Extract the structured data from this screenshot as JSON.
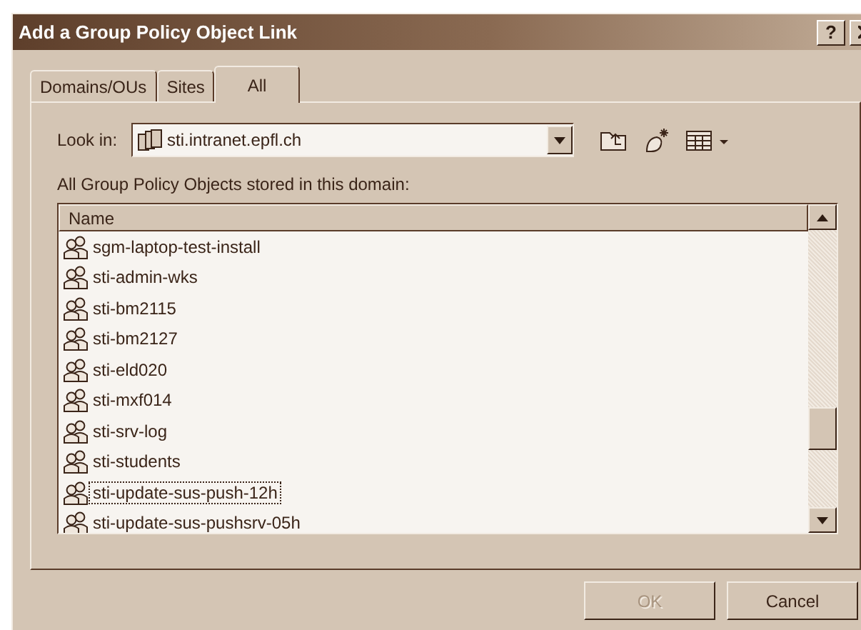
{
  "window": {
    "title": "Add a Group Policy Object Link",
    "help": "?"
  },
  "tabs": [
    {
      "label": "Domains/OUs",
      "selected": false
    },
    {
      "label": "Sites",
      "selected": false
    },
    {
      "label": "All",
      "selected": true
    }
  ],
  "look_in": {
    "label": "Look in:",
    "value": "sti.intranet.epfl.ch"
  },
  "list_caption": "All Group Policy Objects stored in this domain:",
  "list": {
    "column": "Name",
    "items": [
      {
        "name": "sgm-laptop-test-install",
        "selected": false
      },
      {
        "name": "sti-admin-wks",
        "selected": false
      },
      {
        "name": "sti-bm2115",
        "selected": false
      },
      {
        "name": "sti-bm2127",
        "selected": false
      },
      {
        "name": "sti-eld020",
        "selected": false
      },
      {
        "name": "sti-mxf014",
        "selected": false
      },
      {
        "name": "sti-srv-log",
        "selected": false
      },
      {
        "name": "sti-students",
        "selected": false
      },
      {
        "name": "sti-update-sus-push-12h",
        "selected": true
      },
      {
        "name": "sti-update-sus-pushsrv-05h",
        "selected": false
      }
    ]
  },
  "buttons": [
    {
      "label": "OK",
      "disabled": true
    },
    {
      "label": "Cancel",
      "disabled": false
    }
  ]
}
